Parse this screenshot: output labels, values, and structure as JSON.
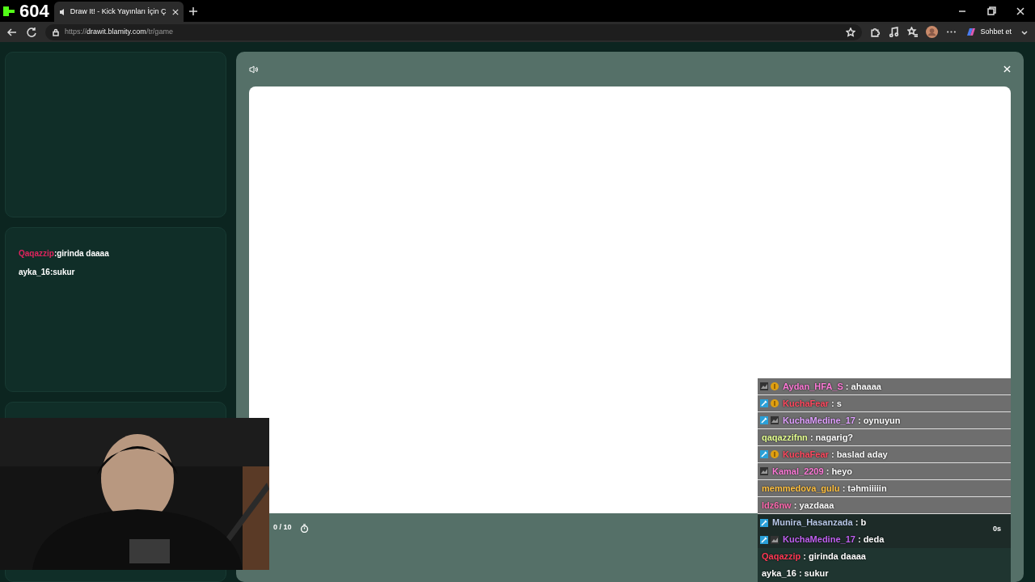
{
  "overlay_counter": "604",
  "browser": {
    "tab_title": "Draw It! - Kick Yayınları İçin Ç",
    "url_prefix": "https://",
    "url_host": "drawit.blamity.com",
    "url_path": "/tr/game",
    "copilot_label": "Sohbet et"
  },
  "side_chat": [
    {
      "user": "Qaqazzip",
      "color": "#e0245e",
      "text": ":girinda daaaa"
    },
    {
      "user": "ayka_16",
      "color": "#ffffff",
      "text": ":sukur"
    }
  ],
  "game": {
    "round": "0 / 10",
    "timer": "0s"
  },
  "stream_chat": [
    {
      "kind": "light",
      "badges": [
        {
          "kind": "sub"
        },
        {
          "kind": "coin"
        }
      ],
      "user": "Aydan_HFA_S",
      "color": "#ff7ad8",
      "text": ": ahaaaa"
    },
    {
      "kind": "light",
      "badges": [
        {
          "kind": "mod"
        },
        {
          "kind": "coin"
        }
      ],
      "user": "KuchaFear",
      "color": "#ff4a60",
      "text": ": s"
    },
    {
      "kind": "light",
      "badges": [
        {
          "kind": "mod"
        },
        {
          "kind": "sub"
        }
      ],
      "user": "KuchaMedine_17",
      "color": "#e0a0ff",
      "text": ": oynuyun"
    },
    {
      "kind": "light",
      "user": "qaqazzifnn",
      "color": "#e4ff90",
      "text": ": nagarig?"
    },
    {
      "kind": "light",
      "badges": [
        {
          "kind": "mod"
        },
        {
          "kind": "coin"
        }
      ],
      "user": "KuchaFear",
      "color": "#ff4a60",
      "text": ": baslad aday"
    },
    {
      "kind": "light",
      "badges": [
        {
          "kind": "sub"
        }
      ],
      "user": "Kamal_2209",
      "color": "#ff7ad8",
      "text": ": heyo"
    },
    {
      "kind": "light",
      "user": "memmedova_gulu",
      "color": "#ffc040",
      "text": ": təhmiiiiin"
    },
    {
      "kind": "light",
      "user": "ldz6nw",
      "color": "#ff6ab0",
      "text": ": yazdaaa"
    },
    {
      "kind": "dark",
      "badges": [
        {
          "kind": "mod"
        }
      ],
      "user": "Munira_Hasanzada",
      "color": "#b8c8e8",
      "text": ": b"
    },
    {
      "kind": "dark",
      "badges": [
        {
          "kind": "mod"
        },
        {
          "kind": "sub"
        }
      ],
      "user": "KuchaMedine_17",
      "color": "#c060f0",
      "text": ": deda"
    },
    {
      "kind": "plain",
      "user": "Qaqazzip",
      "color": "#ff3a55",
      "text": ": girinda daaaa"
    },
    {
      "kind": "plain",
      "user": "ayka_16",
      "color": "#ffffff",
      "text": ": sukur"
    }
  ]
}
